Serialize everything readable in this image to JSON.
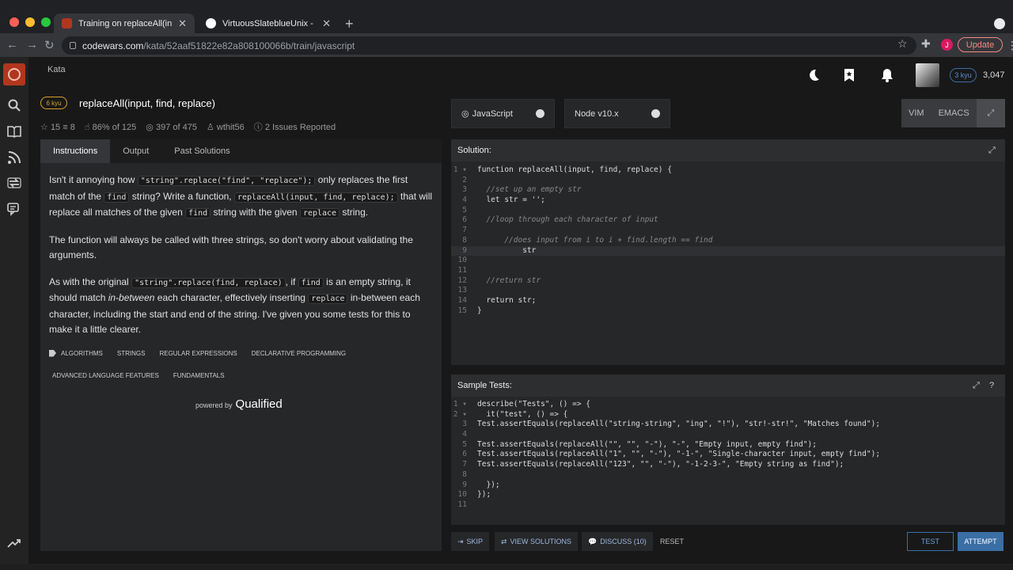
{
  "browser": {
    "tabs": [
      {
        "title": "Training on replaceAll(input, find, replace)",
        "active": true
      },
      {
        "title": "VirtuousSlateblueUnix - Replit",
        "active": false
      }
    ],
    "url_host": "codewars.com",
    "url_path": "/kata/52aaf51822e82a808100066b/train/javascript",
    "profile_initial": "J",
    "update_label": "Update"
  },
  "header": {
    "section": "Kata",
    "rank_badge": "3 kyu",
    "honor": "3,047"
  },
  "kata": {
    "kyu": "6 kyu",
    "title": "replaceAll(input, find, replace)",
    "stars": "15",
    "collections": "8",
    "satisfaction": "86% of 125",
    "completed": "397 of 475",
    "author": "wthit56",
    "issues": "2 Issues Reported"
  },
  "left_tabs": [
    "Instructions",
    "Output",
    "Past Solutions"
  ],
  "description": {
    "p1a": "Isn't it annoying how ",
    "p1c1": "\"string\".replace(\"find\", \"replace\");",
    "p1b": " only replaces the first match of the ",
    "p1c2": "find",
    "p1d": " string? Write a function, ",
    "p1c3": "replaceAll(input, find, replace);",
    "p1e": " that will replace all matches of the given ",
    "p1c4": "find",
    "p1f": " string with the given ",
    "p1c5": "replace",
    "p1g": " string.",
    "p2": "The function will always be called with three strings, so don't worry about validating the arguments.",
    "p3a": "As with the original ",
    "p3c1": "\"string\".replace(find, replace)",
    "p3b": ", if ",
    "p3c2": "find",
    "p3c": " is an empty string, it should match ",
    "p3em": "in-between",
    "p3d": " each character, effectively inserting ",
    "p3c3": "replace",
    "p3e": " in-between each character, including the start and end of the string. I've given you some tests for this to make it a little clearer."
  },
  "tags": [
    "ALGORITHMS",
    "STRINGS",
    "REGULAR EXPRESSIONS",
    "DECLARATIVE PROGRAMMING",
    "ADVANCED LANGUAGE FEATURES",
    "FUNDAMENTALS"
  ],
  "powered": {
    "prefix": "powered by",
    "brand": "Qualified"
  },
  "language": "JavaScript",
  "runtime": "Node v10.x",
  "modes": [
    "VIM",
    "EMACS"
  ],
  "solution": {
    "title": "Solution:",
    "lines": [
      "function replaceAll(input, find, replace) {",
      "",
      "  //set up an empty str",
      "  let str = '';",
      "",
      "  //loop through each character of input",
      "",
      "      //does input from i to i + find.length == find",
      "          str",
      "",
      "",
      "  //return str",
      "",
      "  return str;",
      "}"
    ]
  },
  "tests": {
    "title": "Sample Tests:",
    "lines": [
      "describe(\"Tests\", () => {",
      "  it(\"test\", () => {",
      "Test.assertEquals(replaceAll(\"string-string\", \"ing\", \"!\"), \"str!-str!\", \"Matches found\");",
      "",
      "Test.assertEquals(replaceAll(\"\", \"\", \"-\"), \"-\", \"Empty input, empty find\");",
      "Test.assertEquals(replaceAll(\"1\", \"\", \"-\"), \"-1-\", \"Single-character input, empty find\");",
      "Test.assertEquals(replaceAll(\"123\", \"\", \"-\"), \"-1-2-3-\", \"Empty string as find\");",
      "",
      "  });",
      "});",
      ""
    ]
  },
  "actions": {
    "skip": "SKIP",
    "view_solutions": "VIEW SOLUTIONS",
    "discuss": "DISCUSS (10)",
    "reset": "RESET",
    "test": "TEST",
    "attempt": "ATTEMPT"
  }
}
